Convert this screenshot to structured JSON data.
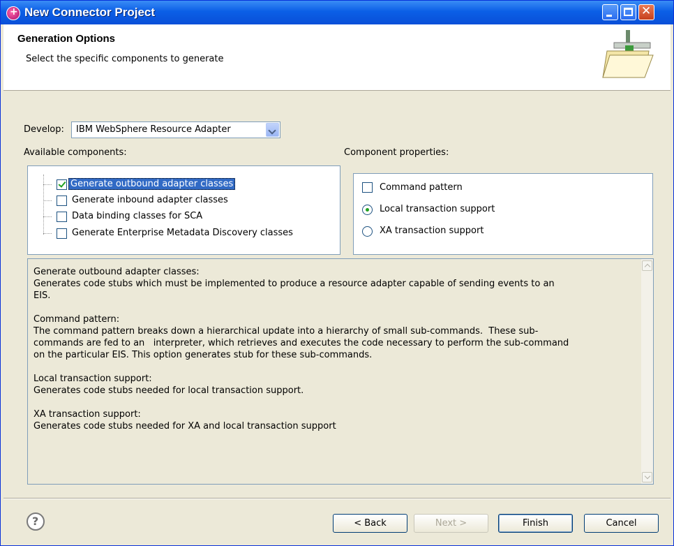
{
  "window": {
    "title": "New Connector Project"
  },
  "header": {
    "title": "Generation Options",
    "description": "Select the specific components to generate"
  },
  "develop": {
    "label": "Develop:",
    "value": "IBM WebSphere Resource Adapter"
  },
  "components": {
    "label": "Available components:",
    "items": [
      {
        "label": "Generate outbound adapter classes",
        "checked": true
      },
      {
        "label": "Generate inbound adapter classes",
        "checked": false
      },
      {
        "label": "Data binding classes for SCA",
        "checked": false
      },
      {
        "label": "Generate Enterprise Metadata Discovery classes",
        "checked": false
      }
    ]
  },
  "properties": {
    "label": "Component properties:",
    "command_pattern": {
      "label": "Command pattern",
      "checked": false
    },
    "local_tx": {
      "label": "Local transaction support",
      "selected": true
    },
    "xa_tx": {
      "label": "XA transaction support",
      "selected": false
    }
  },
  "description_text": "Generate outbound adapter classes:\nGenerates code stubs which must be implemented to produce a resource adapter capable of sending events to an\nEIS.\n\nCommand pattern:\nThe command pattern breaks down a hierarchical update into a hierarchy of small sub-commands.  These sub-\ncommands are fed to an   interpreter, which retrieves and executes the code necessary to perform the sub-command\non the particular EIS. This option generates stub for these sub-commands.\n\nLocal transaction support:\nGenerates code stubs needed for local transaction support.\n\nXA transaction support:\nGenerates code stubs needed for XA and local transaction support",
  "buttons": {
    "back": "< Back",
    "next": "Next >",
    "finish": "Finish",
    "cancel": "Cancel"
  },
  "icons": [
    "app-icon",
    "minimize-icon",
    "maximize-icon",
    "close-icon",
    "wizard-banner-icon",
    "dropdown-arrow-icon",
    "help-icon",
    "scroll-up-icon",
    "scroll-down-icon"
  ]
}
